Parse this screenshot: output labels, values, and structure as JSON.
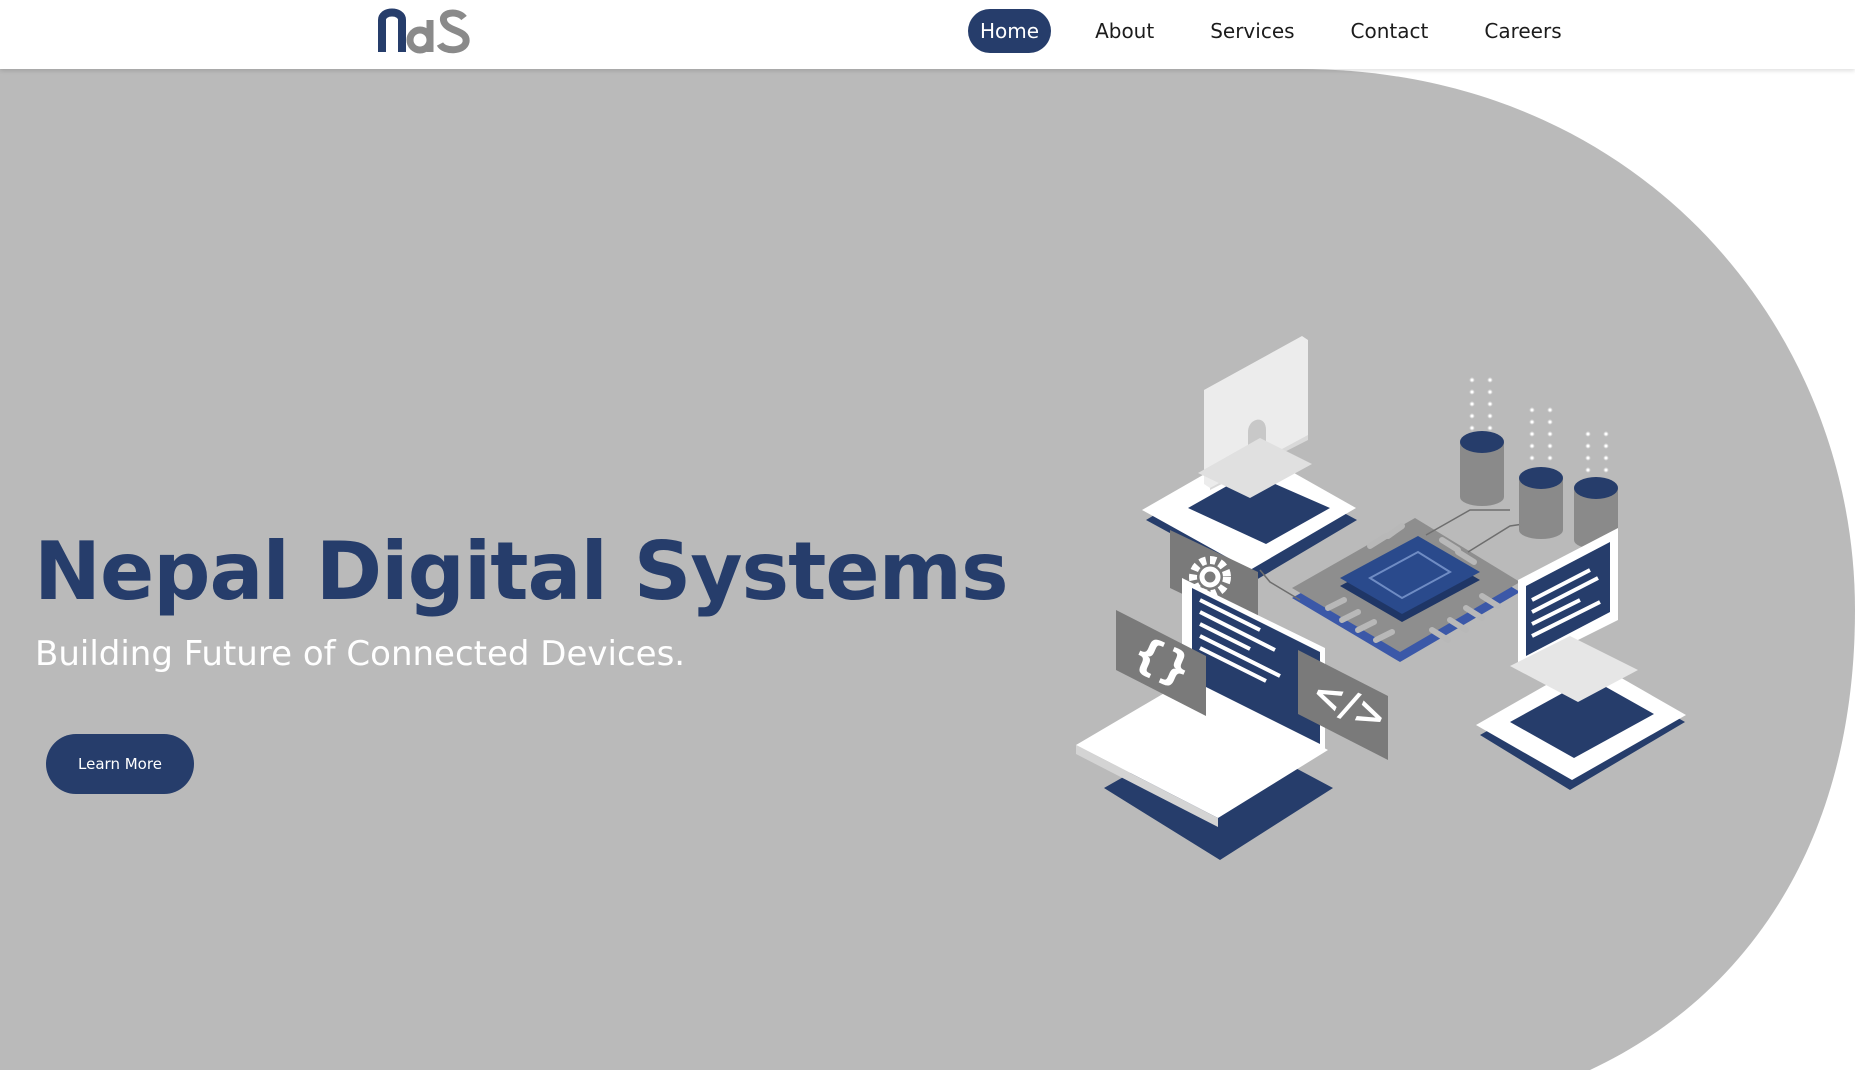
{
  "brand": {
    "logo_text": "NdS",
    "primary_color": "#263d6b",
    "secondary_color": "#8a8a8a"
  },
  "nav": {
    "items": [
      {
        "label": "Home",
        "active": true
      },
      {
        "label": "About",
        "active": false
      },
      {
        "label": "Services",
        "active": false
      },
      {
        "label": "Contact",
        "active": false
      },
      {
        "label": "Careers",
        "active": false
      }
    ]
  },
  "hero": {
    "title": "Nepal Digital Systems",
    "subtitle": "Building Future of Connected Devices.",
    "cta_label": "Learn More",
    "background_color": "#bababa",
    "illustration_icon": "isometric-tech-illustration-icon",
    "code_tag": "</>",
    "braces": "{}"
  }
}
